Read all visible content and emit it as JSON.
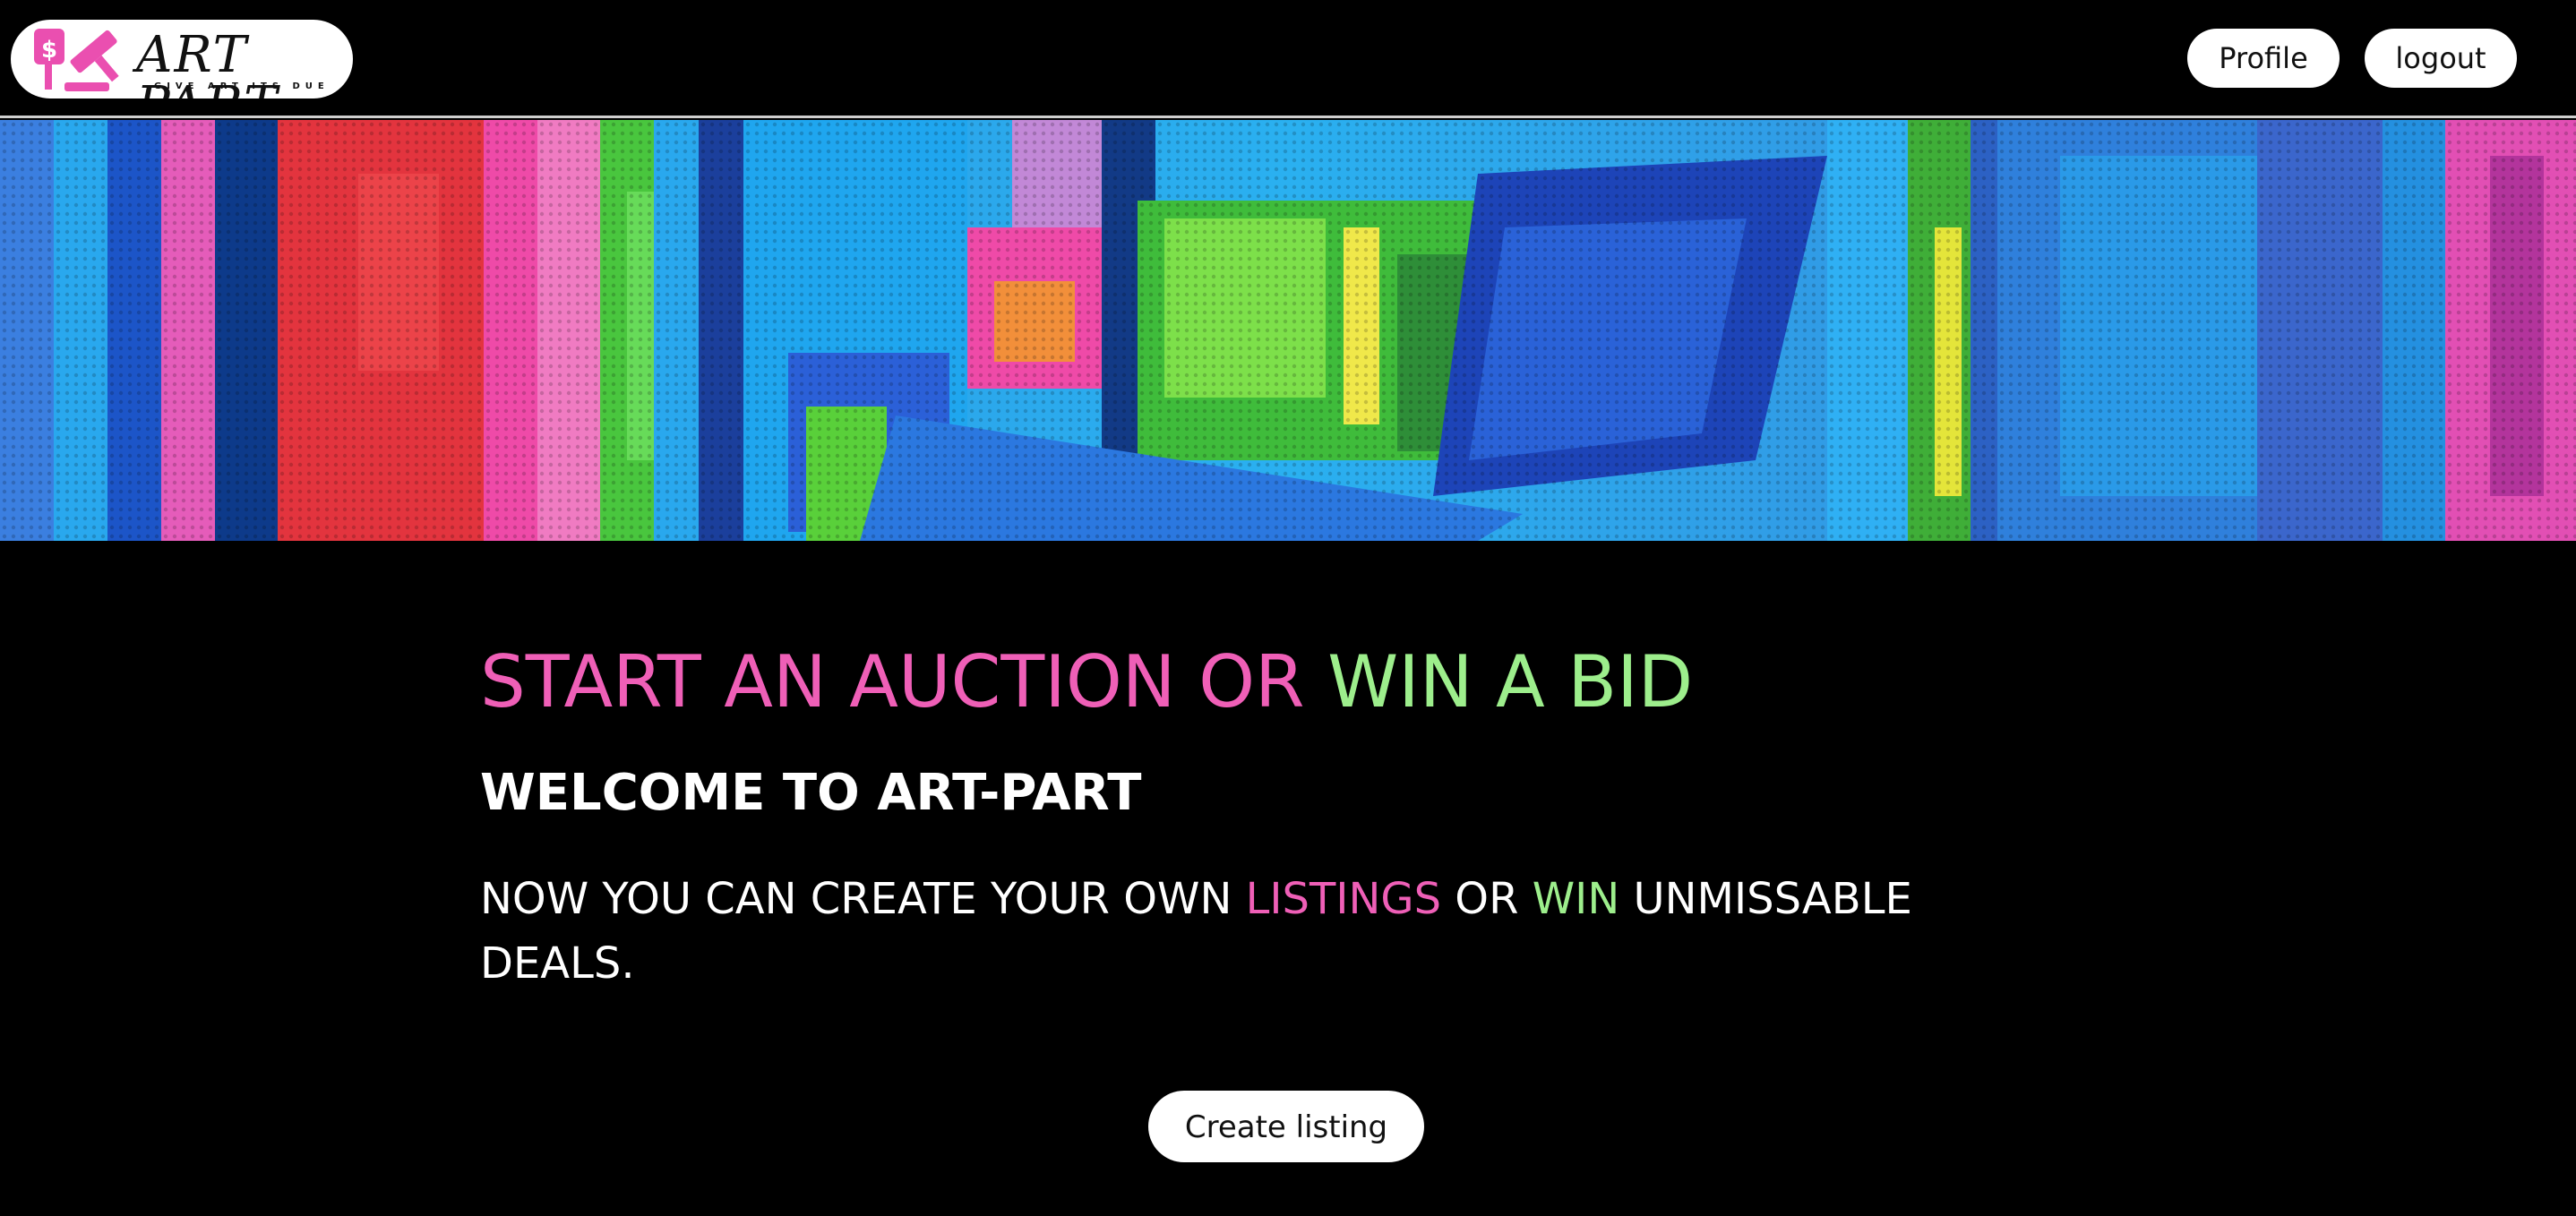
{
  "header": {
    "logo": {
      "title": "ART PART",
      "tagline": "GIVE ART ITS DUE",
      "icon": "gavel-price-tag-icon"
    },
    "nav": {
      "profile_label": "Profile",
      "logout_label": "logout"
    }
  },
  "banner": {
    "image": "abstract-paint-banner"
  },
  "hero": {
    "heading": {
      "part1": "START AN AUCTION OR ",
      "part2": "WIN A BID"
    },
    "welcome": "WELCOME TO ART-PART",
    "description": {
      "part1": "NOW YOU CAN CREATE YOUR OWN ",
      "listings": "LISTINGS",
      "part2": " OR ",
      "win": "WIN",
      "part3": " UNMISSABLE DEALS."
    },
    "create_label": "Create listing"
  },
  "colors": {
    "background": "#000000",
    "pink_accent": "#ef5fb7",
    "green_accent": "#9dee8c",
    "button_bg": "#ffffff"
  }
}
